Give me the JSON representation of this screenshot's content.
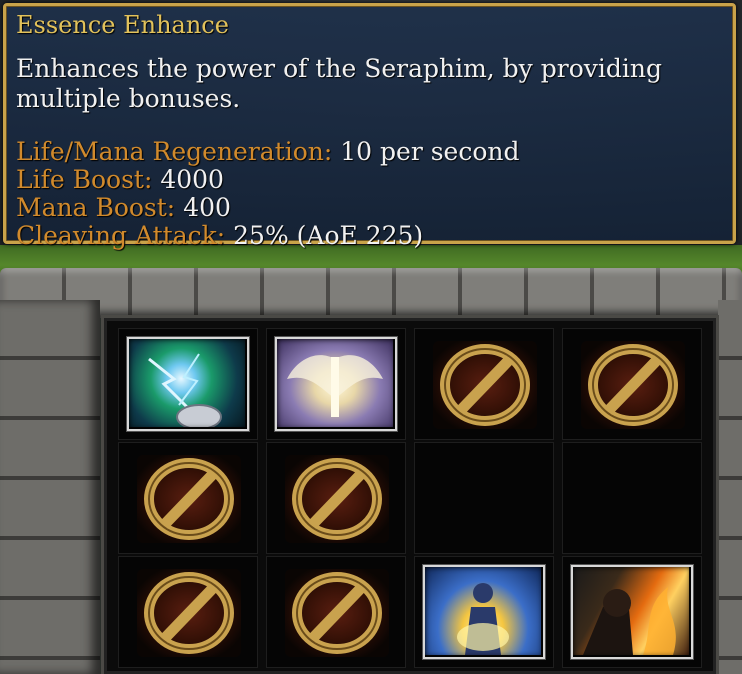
{
  "tooltip": {
    "title": "Essence Enhance",
    "description": "Enhances the power of the Seraphim, by providing multiple bonuses.",
    "stats": [
      {
        "label": "Life/Mana Regeneration:",
        "value": "10 per second"
      },
      {
        "label": "Life Boost:",
        "value": "4000"
      },
      {
        "label": "Mana Boost:",
        "value": "400"
      },
      {
        "label": "Cleaving Attack:",
        "value": "25% (AoE 225)"
      }
    ]
  },
  "inventory": {
    "rows": [
      [
        "lightning-gauntlet-icon",
        "seraph-wings-icon",
        "disabled-slot-icon",
        "disabled-slot-icon"
      ],
      [
        "disabled-slot-icon",
        "disabled-slot-icon",
        "empty",
        "empty"
      ],
      [
        "disabled-slot-icon",
        "disabled-slot-icon",
        "holy-light-icon",
        "fire-warrior-icon"
      ]
    ]
  },
  "colors": {
    "title": "#e2c25b",
    "stat_label": "#d18a2c",
    "text": "#f1f1f1",
    "tooltip_border": "#c9a34a"
  }
}
